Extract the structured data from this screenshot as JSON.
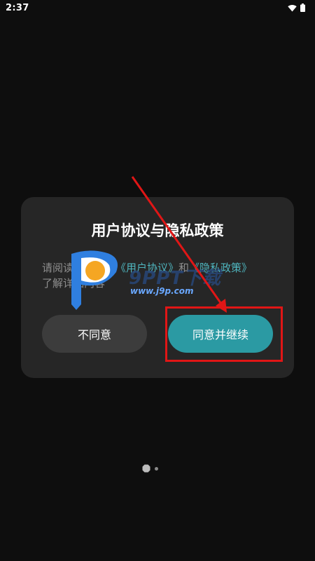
{
  "status_bar": {
    "time": "2:37",
    "icons": [
      "wifi-icon",
      "battery-icon"
    ]
  },
  "dialog": {
    "title": "用户协议与隐私政策",
    "body_prefix": "请阅读并完整的",
    "user_agreement_link": "《用户协议》",
    "connector": "和",
    "privacy_policy_link": "《隐私政策》",
    "body_suffix": "了解详细内容",
    "decline_label": "不同意",
    "accept_label": "同意并继续"
  },
  "watermark": {
    "brand": "9PPT下载",
    "url": "www.j9p.com"
  },
  "page_indicator": {
    "count": 2,
    "active_index": 0
  },
  "colors": {
    "background": "#0e0e0e",
    "dialog": "#262626",
    "accent": "#2b9aa3",
    "link": "#4fb6bf",
    "annotation": "#e01616"
  }
}
